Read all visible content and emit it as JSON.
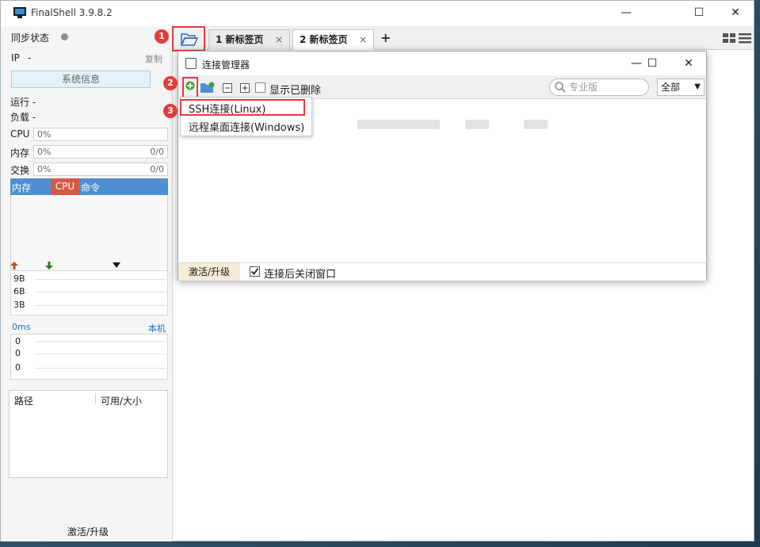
{
  "window": {
    "title": "FinalShell 3.9.8.2",
    "controls": {
      "minimize": "—",
      "maximize": "☐",
      "close": "✕"
    }
  },
  "left_panel": {
    "sync_label": "同步状态",
    "ip_label": "IP",
    "ip_value": "-",
    "copy_label": "复制",
    "sysinfo_button": "系统信息",
    "run_label": "运行 -",
    "load_label": "负载 -",
    "cpu": {
      "label": "CPU",
      "value": "0%"
    },
    "mem": {
      "label": "内存",
      "value": "0%",
      "ratio": "0/0"
    },
    "swap": {
      "label": "交换",
      "value": "0%",
      "ratio": "0/0"
    },
    "proc_header": {
      "mem": "内存",
      "cpu": "CPU",
      "cmd": "命令"
    },
    "net": {
      "up_icon": "arrow-up-icon",
      "down_icon": "arrow-down-icon",
      "rows": [
        "9B",
        "6B",
        "3B"
      ]
    },
    "ping": {
      "label": "0ms",
      "host": "本机",
      "rows": [
        "0",
        "0",
        "0"
      ]
    },
    "disk": {
      "path_header": "路径",
      "size_header": "可用/大小"
    },
    "activate": "激活/升级"
  },
  "tabs": [
    {
      "label": "1 新标签页",
      "close": "×"
    },
    {
      "label": "2 新标签页",
      "close": "×"
    }
  ],
  "add_tab": "+",
  "dialog": {
    "title": "连接管理器",
    "controls": {
      "minimize": "—",
      "maximize": "☐",
      "close": "✕"
    },
    "show_deleted": "显示已删除",
    "search_placeholder": "专业版",
    "filter_value": "全部",
    "menu": [
      "SSH连接(Linux)",
      "远程桌面连接(Windows)"
    ],
    "footer_activate": "激活/升级",
    "close_after_connect": "连接后关闭窗口"
  },
  "badges": [
    "1",
    "2",
    "3"
  ],
  "colors": {
    "accent_red": "#e23c3c",
    "proc_blue": "#4f8fd1",
    "proc_cpu": "#d45a45"
  }
}
